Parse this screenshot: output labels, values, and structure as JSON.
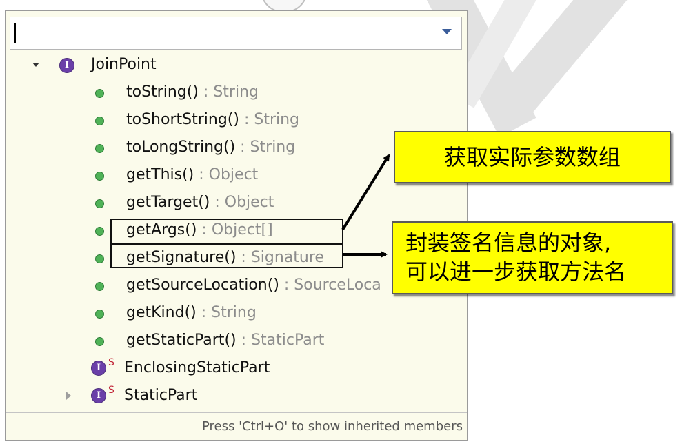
{
  "outline": {
    "filter": {
      "value": ""
    },
    "root": {
      "label": "JoinPoint",
      "icon": "interface-icon",
      "expanded": true
    },
    "methods": [
      {
        "name": "toString()",
        "type": " : String"
      },
      {
        "name": "toShortString()",
        "type": " : String"
      },
      {
        "name": "toLongString()",
        "type": " : String"
      },
      {
        "name": "getThis()",
        "type": " : Object"
      },
      {
        "name": "getTarget()",
        "type": " : Object"
      },
      {
        "name": "getArgs()",
        "type": " : Object[]"
      },
      {
        "name": "getSignature()",
        "type": " : Signature"
      },
      {
        "name": "getSourceLocation()",
        "type": " : SourceLoca"
      },
      {
        "name": "getKind()",
        "type": " : String"
      },
      {
        "name": "getStaticPart()",
        "type": " : StaticPart"
      }
    ],
    "inner_types": [
      {
        "label": "EnclosingStaticPart",
        "icon": "interface-icon",
        "marker": "S",
        "expandable": false
      },
      {
        "label": "StaticPart",
        "icon": "interface-icon",
        "marker": "S",
        "expandable": true
      }
    ],
    "status_text": "Press 'Ctrl+O' to show inherited members"
  },
  "annotations": [
    {
      "text_lines": [
        "获取实际参数数组"
      ]
    },
    {
      "text_lines": [
        "封装签名信息的对象,",
        "可以进一步获取方法名"
      ]
    }
  ],
  "colors": {
    "callout_fill": "#ffff00",
    "popup_background": "#fbfbeb",
    "method_icon": "#4fb257",
    "interface_icon": "#6a3fa8",
    "static_marker": "#c2273a",
    "type_text": "#8c8c8c"
  }
}
